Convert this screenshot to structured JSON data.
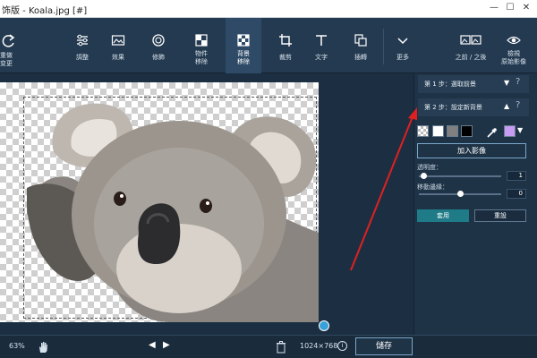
{
  "window": {
    "title": "饰版 - Koala.jpg [#]",
    "min_glyph": "—",
    "max_glyph": "☐",
    "close_glyph": "✕"
  },
  "toolbar": {
    "redo_label": "重做\n变更",
    "tools": [
      {
        "label": "調整",
        "icon": "sliders-icon"
      },
      {
        "label": "效果",
        "icon": "effects-icon"
      },
      {
        "label": "修飾",
        "icon": "retouch-icon"
      },
      {
        "label": "物件\n移除",
        "icon": "object-removal-icon"
      },
      {
        "label": "背景\n移除",
        "icon": "background-removal-icon",
        "active": true
      },
      {
        "label": "裁剪",
        "icon": "crop-icon"
      },
      {
        "label": "文字",
        "icon": "text-icon"
      },
      {
        "label": "插轉",
        "icon": "layers-icon"
      },
      {
        "label": "更多",
        "icon": "chevron-down-icon"
      }
    ],
    "compare_label": "之前 / 之後",
    "preview_label": "檢視\n原始影像"
  },
  "panel": {
    "step1": "第 1 步：選取前景",
    "step1_arrow": "▼",
    "step2": "第 2 步：設定新背景",
    "step2_arrow": "▲",
    "help": "?",
    "swatch_colors": [
      "#ffffff",
      "#808080",
      "#000000",
      "#c79cf2"
    ],
    "add_image": "加入影像",
    "transparency_label": "透明度：",
    "transparency_value": "1",
    "shift_label": "移動邊緣：",
    "shift_value": "0",
    "apply": "套用",
    "reset": "重設"
  },
  "bottom": {
    "zoom": "63%",
    "prev": "◀",
    "next": "▶",
    "size": "1024×768",
    "info": "i",
    "save": "儲存"
  },
  "sliders": {
    "transparency_fraction": 0.05,
    "shift_fraction": 0.5
  },
  "colors": {
    "accent": "#1e7b87",
    "panel_bg": "#1f3347",
    "annotation_arrow": "#e02020"
  }
}
